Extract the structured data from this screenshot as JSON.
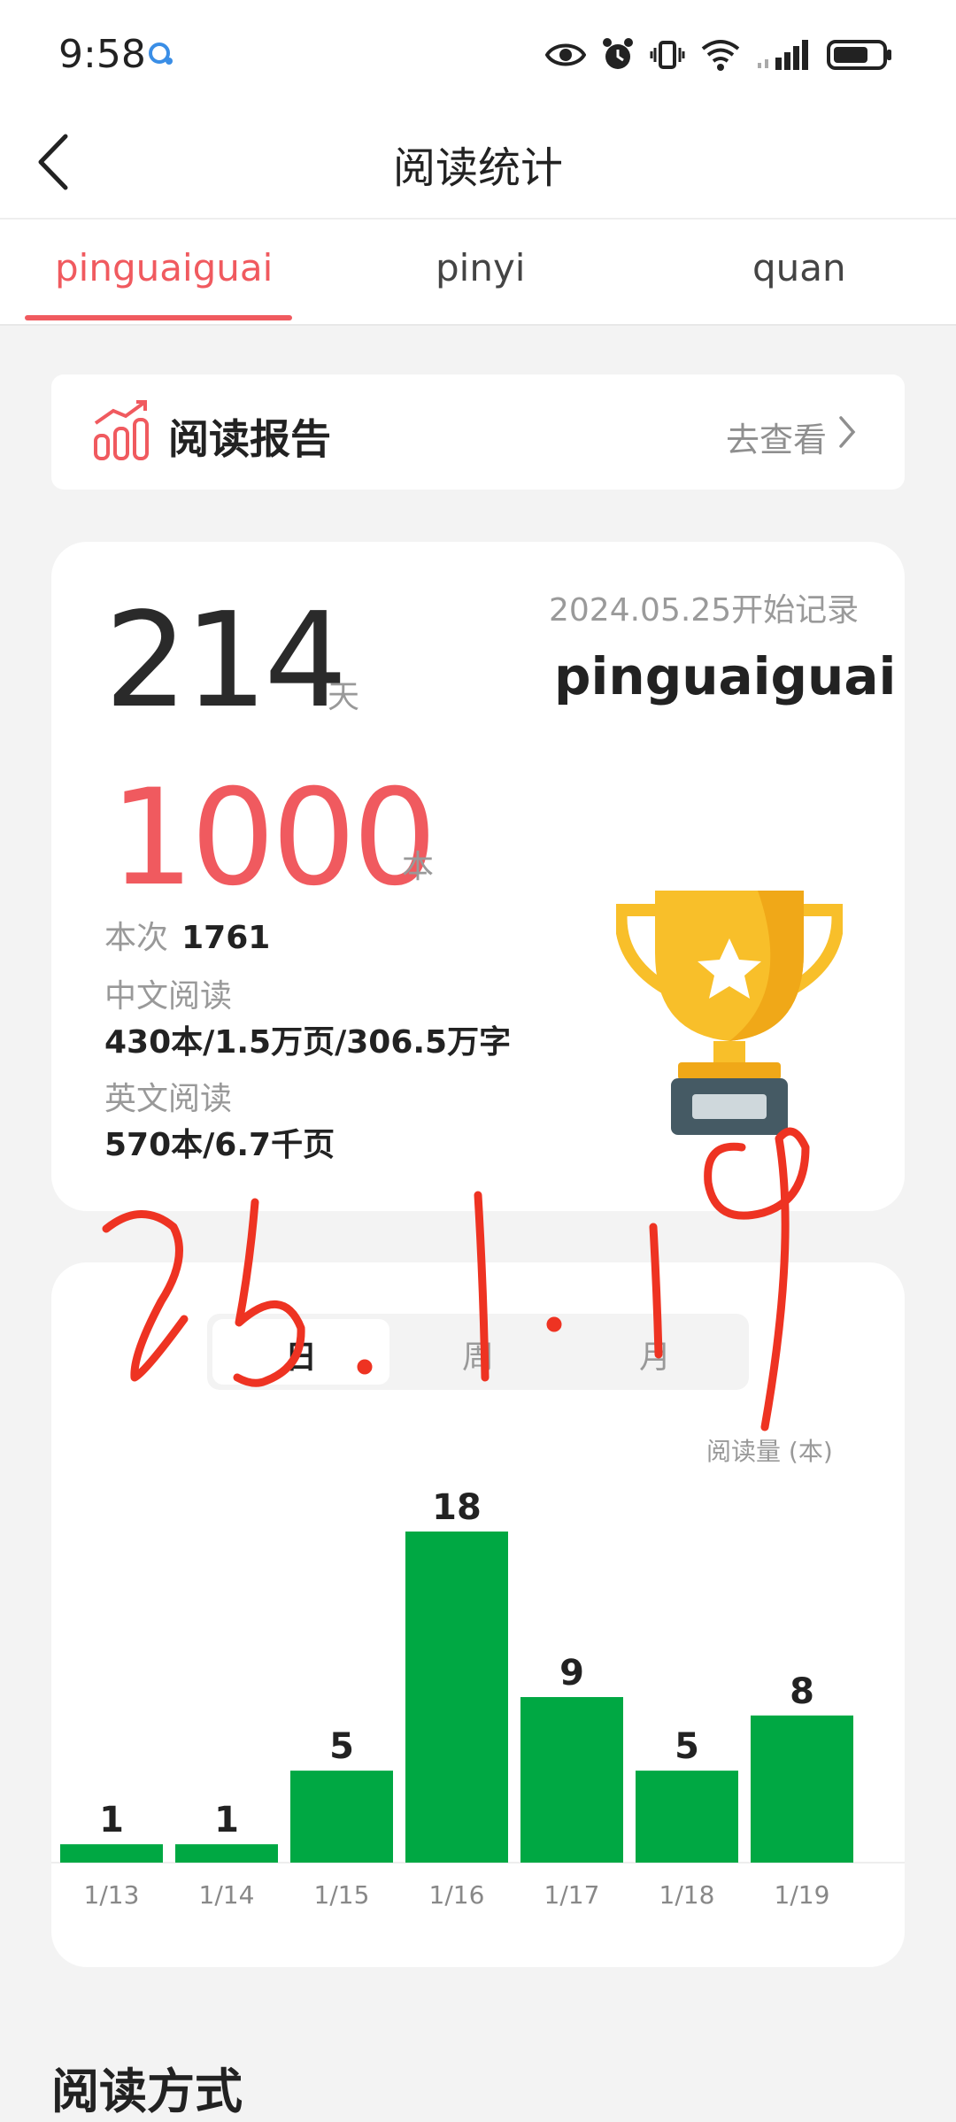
{
  "status_bar": {
    "time": "9:58",
    "icons": [
      "chat-bubble-icon",
      "eye-icon",
      "alarm-icon",
      "vibrate-icon",
      "wifi-icon",
      "signal-icon",
      "battery-icon"
    ]
  },
  "header": {
    "title": "阅读统计",
    "back_icon": "chevron-left-icon"
  },
  "tabs": [
    {
      "label": "pinguaiguai",
      "active": true
    },
    {
      "label": "pinyi",
      "active": false
    },
    {
      "label": "quan",
      "active": false
    }
  ],
  "report": {
    "title": "阅读报告",
    "link": "去查看",
    "icon": "bar-chart-icon"
  },
  "stats": {
    "days": "214",
    "days_unit": "天",
    "start_date": "2024.05.25开始记录",
    "username": "pinguaiguai",
    "books": "1000",
    "books_unit": "本",
    "times_label": "本次",
    "times_value": "1761",
    "chinese_label": "中文阅读",
    "chinese_value": "430本/1.5万页/306.5万字",
    "english_label": "英文阅读",
    "english_value": "570本/6.7千页",
    "trophy_icon": "trophy-icon"
  },
  "chart_controls": {
    "segments": [
      "日",
      "周",
      "月"
    ],
    "active_segment": "日",
    "unit_label": "阅读量 (本)"
  },
  "chart_data": {
    "type": "bar",
    "categories": [
      "1/13",
      "1/14",
      "1/15",
      "1/16",
      "1/17",
      "1/18",
      "1/19"
    ],
    "values": [
      1,
      1,
      5,
      18,
      9,
      5,
      8
    ],
    "ylabel": "阅读量 (本)",
    "bar_color": "#00a843",
    "grid": false,
    "data_labels": true
  },
  "section": {
    "title": "阅读方式"
  },
  "annotation": {
    "handwritten_text": "25.1.19",
    "color": "#ee3322"
  },
  "colors": {
    "accent": "#f05a5f",
    "bar": "#00a843",
    "background": "#f3f3f3"
  }
}
